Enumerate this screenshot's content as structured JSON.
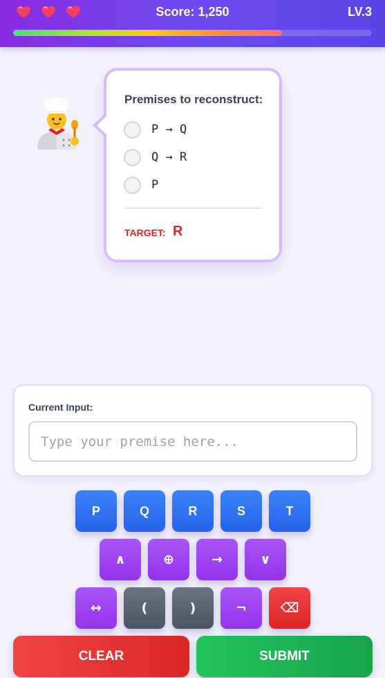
{
  "hud": {
    "lives": 3,
    "score_text": "Score: 1,250",
    "level_text": "LV.3",
    "progress_fraction": 0.75,
    "heart_color": "#ef4444"
  },
  "bubble": {
    "title": "Premises to reconstruct:",
    "premises": [
      {
        "text": "P → Q",
        "checked": false
      },
      {
        "text": "Q → R",
        "checked": false
      },
      {
        "text": "P",
        "checked": false
      }
    ],
    "target_label": "TARGET:",
    "target_value": "R"
  },
  "input": {
    "label": "Current Input:",
    "placeholder": "Type your premise here...",
    "value": ""
  },
  "keypad": {
    "row1": [
      "P",
      "Q",
      "R",
      "S",
      "T"
    ],
    "row2": [
      "∧",
      "⊕",
      "→",
      "∨"
    ],
    "row3": [
      "↔",
      "(",
      ")",
      "¬",
      "⌫"
    ]
  },
  "actions": {
    "clear_label": "CLEAR",
    "submit_label": "SUBMIT"
  },
  "colors": {
    "header_gradient_start": "#8a2ce2",
    "header_gradient_end": "#5b45e6",
    "variable_key": "#2563eb",
    "operator_key": "#9333ea",
    "paren_key": "#4b5563",
    "delete_key": "#dc2626",
    "clear_button": "#dc2626",
    "submit_button": "#16a34a",
    "target": "#dc2626"
  }
}
